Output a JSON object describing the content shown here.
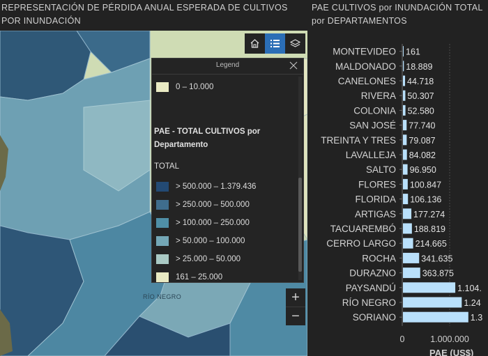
{
  "map": {
    "title": "REPRESENTACIÓN DE PÉRDIDA ANUAL ESPERADA DE CULTIVOS POR INUNDACIÓN",
    "map_label": "RÍO NEGRO",
    "tools": [
      {
        "name": "home-icon",
        "active": false
      },
      {
        "name": "legend-list-icon",
        "active": true
      },
      {
        "name": "layers-icon",
        "active": false
      }
    ],
    "zoom_in": "+",
    "zoom_out": "−"
  },
  "legend": {
    "title": "Legend",
    "top_item": {
      "label": "0 – 10.000",
      "color": "#e9eac3"
    },
    "layer_title": "PAE - TOTAL CULTIVOS por Departamento",
    "field": "TOTAL",
    "items": [
      {
        "label": "> 500.000 – 1.379.436",
        "color": "#234a74"
      },
      {
        "label": "> 250.000 – 500.000",
        "color": "#3f6d8d"
      },
      {
        "label": "> 100.000 – 250.000",
        "color": "#4f8fa7"
      },
      {
        "label": "> 50.000 – 100.000",
        "color": "#74a7b6"
      },
      {
        "label": "> 25.000 – 50.000",
        "color": "#a9c9c4"
      },
      {
        "label": "161 – 25.000",
        "color": "#e9eac3"
      }
    ]
  },
  "chart_data": {
    "type": "bar",
    "orientation": "horizontal",
    "title": "PAE CULTIVOS por INUNDACIÓN TOTAL por DEPARTAMENTOS",
    "categories": [
      "MONTEVIDEO",
      "MALDONADO",
      "CANELONES",
      "RIVERA",
      "COLONIA",
      "SAN JOSÉ",
      "TREINTA Y TRES",
      "LAVALLEJA",
      "SALTO",
      "FLORES",
      "FLORIDA",
      "ARTIGAS",
      "TACUAREMBÓ",
      "CERRO LARGO",
      "ROCHA",
      "DURAZNO",
      "PAYSANDÚ",
      "RÍO NEGRO",
      "SORIANO"
    ],
    "values": [
      161,
      18889,
      44718,
      50307,
      52580,
      77740,
      79087,
      84082,
      96950,
      100847,
      106136,
      177274,
      188819,
      214665,
      341635,
      363875,
      1104000,
      1240000,
      1379436
    ],
    "value_labels": [
      "161",
      "18.889",
      "44.718",
      "50.307",
      "52.580",
      "77.740",
      "79.087",
      "84.082",
      "96.950",
      "100.847",
      "106.136",
      "177.274",
      "188.819",
      "214.665",
      "341.635",
      "363.875",
      "1.104.",
      "1.24",
      "1.3"
    ],
    "x_ticks": [
      0,
      1000000,
      2000000
    ],
    "x_tick_labels": [
      "0",
      "1.000.000",
      "2"
    ],
    "xlabel": "PAE (US$)",
    "xlim": [
      0,
      2000000
    ],
    "bar_color": "#b9e0fb",
    "grid": true
  }
}
